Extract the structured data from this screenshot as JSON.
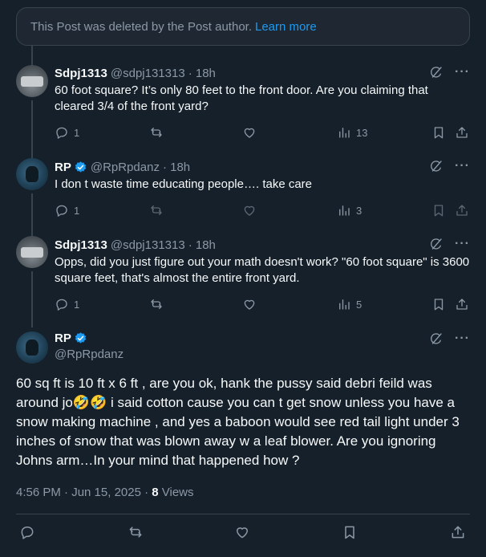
{
  "deleted_notice": {
    "text": "This Post was deleted by the Post author.",
    "link": "Learn more"
  },
  "replies": [
    {
      "name": "Sdpj1313",
      "handle": "@sdpj131313",
      "time": "· 18h",
      "text": "60 foot square? It’s only 80 feet to the front door. Are you claiming that cleared 3/4 of the front yard?",
      "replies_count": "1",
      "views": "13",
      "verified": false
    },
    {
      "name": "RP",
      "handle": "@RpRpdanz",
      "time": "· 18h",
      "text": "I don t waste time educating people…. take care",
      "replies_count": "1",
      "views": "3",
      "verified": true
    },
    {
      "name": "Sdpj1313",
      "handle": "@sdpj131313",
      "time": "· 18h",
      "text": "Opps, did you just figure out your math doesn't work? \"60 foot square\" is 3600 square feet, that's almost the entire front yard.",
      "replies_count": "1",
      "views": "5",
      "verified": false
    }
  ],
  "main_post": {
    "name": "RP",
    "handle": "@RpRpdanz",
    "text": "60 sq ft is 10 ft x 6 ft , are you ok, hank the pussy said debri feild was around jo🤣🤣 i said cotton cause you can t get snow unless you have a snow making machine , and yes a baboon would see red tail light under 3 inches of snow that was blown away w a leaf blower. Are you ignoring Johns arm…In your mind that happened how ?",
    "timestamp": "4:56 PM · Jun 15, 2025 · ",
    "views_count": "8",
    "views_label": " Views"
  },
  "icons": {
    "reply": "speech-bubble-icon",
    "repost": "repost-arrows-icon",
    "like": "heart-icon",
    "views": "bar-chart-icon",
    "bookmark": "bookmark-icon",
    "share": "share-upload-icon",
    "grok": "grok-slash-circle-icon",
    "more": "more-dots-icon",
    "verified": "verified-badge-icon"
  },
  "colors": {
    "background": "#15202b",
    "accent": "#1d9bf0",
    "muted": "#8b98a5",
    "border": "#38444d"
  }
}
